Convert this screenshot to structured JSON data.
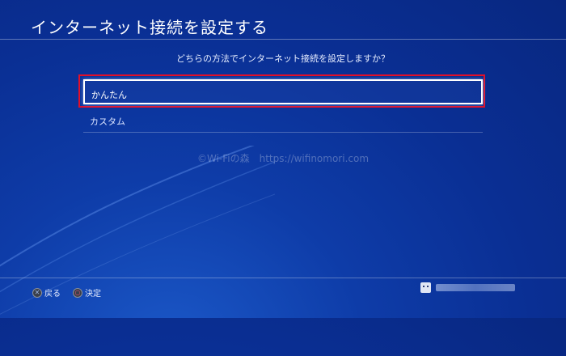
{
  "header": {
    "title": "インターネット接続を設定する"
  },
  "question": "どちらの方法でインターネット接続を設定しますか？",
  "menu": {
    "items": [
      {
        "label": "かんたん",
        "selected": true
      },
      {
        "label": "カスタム",
        "selected": false
      }
    ]
  },
  "watermark": "©Wi-Fiの森　https://wifinomori.com",
  "footer": {
    "back": {
      "icon": "cross-button-icon",
      "label": "戻る"
    },
    "confirm": {
      "icon": "circle-button-icon",
      "label": "決定"
    },
    "user": {
      "avatar": "user-avatar-icon"
    }
  },
  "colors": {
    "background": "#0a2f94",
    "highlight_frame": "#e0102a",
    "selection_border": "#ffffff"
  }
}
